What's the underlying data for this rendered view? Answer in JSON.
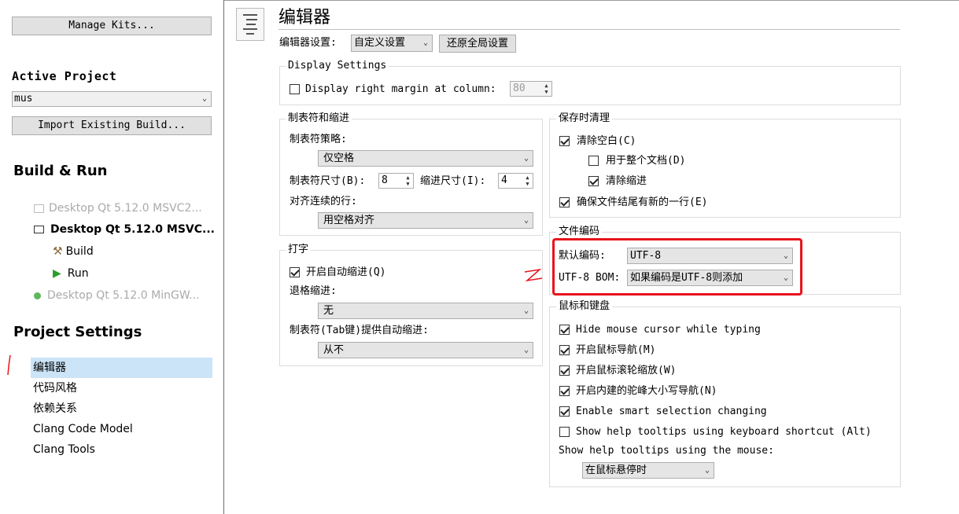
{
  "sidebar": {
    "manage_kits": "Manage Kits...",
    "active_project_label": "Active Project",
    "active_project_value": "mus",
    "import_build": "Import Existing Build...",
    "build_run_label": "Build & Run",
    "kit_msvc_disabled": "Desktop Qt 5.12.0 MSVC2...",
    "kit_msvc_active": "Desktop Qt 5.12.0 MSVC...",
    "build": "Build",
    "run": "Run",
    "kit_mingw": "Desktop Qt 5.12.0 MinGW...",
    "project_settings_label": "Project Settings",
    "items": [
      {
        "label": "编辑器"
      },
      {
        "label": "代码风格"
      },
      {
        "label": "依赖关系"
      },
      {
        "label": "Clang Code Model"
      },
      {
        "label": "Clang Tools"
      }
    ]
  },
  "editor": {
    "title": "编辑器",
    "settings_label": "编辑器设置:",
    "settings_value": "自定义设置",
    "restore_global": "还原全局设置",
    "display": {
      "title": "Display Settings",
      "right_margin_label": "Display right margin at column:",
      "right_margin_value": "80",
      "right_margin_checked": false
    },
    "tabs": {
      "title": "制表符和缩进",
      "policy_label": "制表符策略:",
      "policy_value": "仅空格",
      "tab_size_label": "制表符尺寸(B):",
      "tab_size_value": "8",
      "indent_size_label": "缩进尺寸(I):",
      "indent_size_value": "4",
      "align_label": "对齐连续的行:",
      "align_value": "用空格对齐"
    },
    "typing": {
      "title": "打字",
      "auto_indent_label": "开启自动缩进(Q)",
      "auto_indent_checked": true,
      "backspace_label": "退格缩进:",
      "backspace_value": "无",
      "tab_auto_indent_label": "制表符(Tab键)提供自动缩进:",
      "tab_auto_indent_value": "从不"
    },
    "cleanup": {
      "title": "保存时清理",
      "clean_whitespace": "清除空白(C)",
      "whole_document": "用于整个文档(D)",
      "clean_indent": "清除缩进",
      "ensure_newline": "确保文件结尾有新的一行(E)"
    },
    "encoding": {
      "title": "文件编码",
      "default_label": "默认编码:",
      "default_value": "UTF-8",
      "bom_label": "UTF-8 BOM:",
      "bom_value": "如果编码是UTF-8则添加"
    },
    "mouse": {
      "title": "鼠标和键盘",
      "options": [
        {
          "label": "Hide mouse cursor while typing",
          "checked": true
        },
        {
          "label": "开启鼠标导航(M)",
          "checked": true
        },
        {
          "label": "开启鼠标滚轮缩放(W)",
          "checked": true
        },
        {
          "label": "开启内建的驼峰大小写导航(N)",
          "checked": true
        },
        {
          "label": "Enable smart selection changing",
          "checked": true
        },
        {
          "label": "Show help tooltips using keyboard shortcut (Alt)",
          "checked": false
        }
      ],
      "tooltip_label": "Show help tooltips using the mouse:",
      "tooltip_value": "在鼠标悬停时"
    }
  },
  "colors": {
    "highlight_box": "#e8141c",
    "annotation": "#e8141c",
    "selected_item": "#cce4f7",
    "run_green": "#2a9d2a"
  }
}
